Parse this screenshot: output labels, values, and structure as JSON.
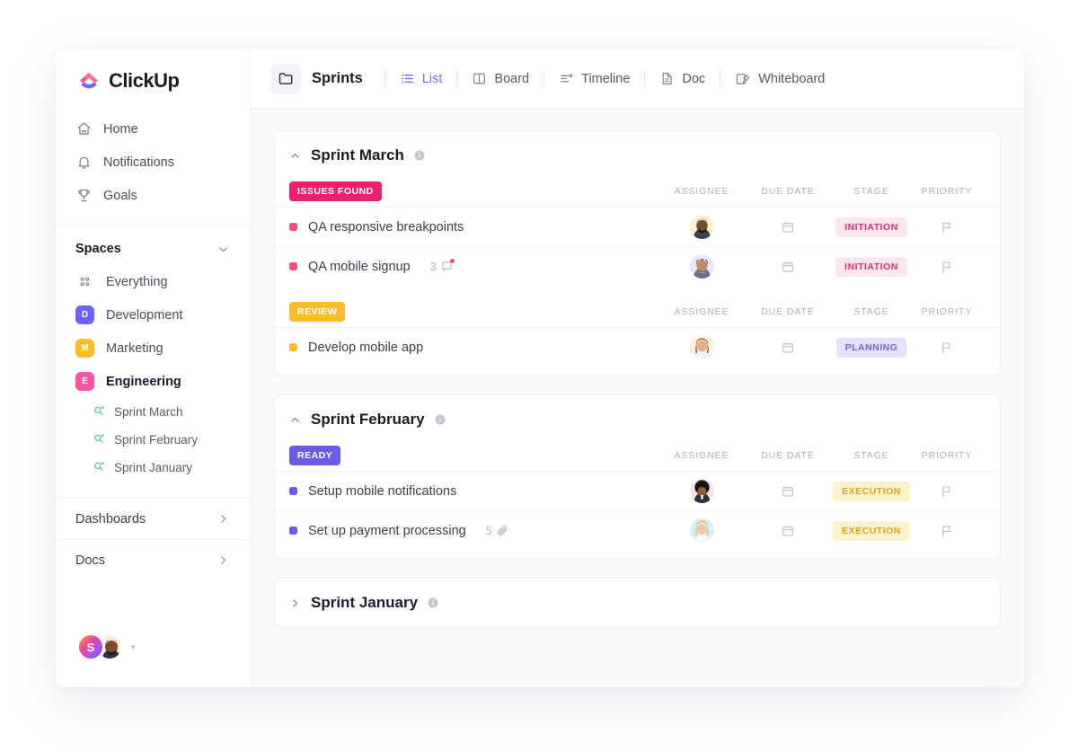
{
  "brand": {
    "name": "ClickUp",
    "accent": "#7b68ee"
  },
  "sidebar": {
    "nav": [
      {
        "label": "Home",
        "icon": "home-icon"
      },
      {
        "label": "Notifications",
        "icon": "bell-icon"
      },
      {
        "label": "Goals",
        "icon": "trophy-icon"
      }
    ],
    "spaces_title": "Spaces",
    "everything": {
      "label": "Everything",
      "icon": "grid-dots-icon"
    },
    "spaces": [
      {
        "label": "Development",
        "initial": "D",
        "color": "#6c63ff",
        "active": false
      },
      {
        "label": "Marketing",
        "initial": "M",
        "color": "#fbbc2e",
        "active": false
      },
      {
        "label": "Engineering",
        "initial": "E",
        "color": "#f754a2",
        "active": true
      }
    ],
    "sprints": [
      {
        "label": "Sprint  March"
      },
      {
        "label": "Sprint  February"
      },
      {
        "label": "Sprint January"
      }
    ],
    "sections": [
      {
        "label": "Dashboards"
      },
      {
        "label": "Docs"
      }
    ],
    "user": {
      "initial": "S"
    }
  },
  "toolbar": {
    "folder": "Sprints",
    "tabs": [
      {
        "label": "List",
        "icon": "list-icon",
        "active": true
      },
      {
        "label": "Board",
        "icon": "board-icon",
        "active": false
      },
      {
        "label": "Timeline",
        "icon": "timeline-icon",
        "active": false
      },
      {
        "label": "Doc",
        "icon": "doc-icon",
        "active": false
      },
      {
        "label": "Whiteboard",
        "icon": "whiteboard-icon",
        "active": false
      }
    ]
  },
  "columns": {
    "assignee": "ASSIGNEE",
    "due_date": "DUE DATE",
    "stage": "STAGE",
    "priority": "PRIORITY"
  },
  "sprints": [
    {
      "name": "Sprint March",
      "expanded": true,
      "groups": [
        {
          "status": "ISSUES FOUND",
          "status_bg": "#e8246c",
          "tasks": [
            {
              "title": "QA responsive breakpoints",
              "dot": "#f04f7f",
              "meta_count": "",
              "meta_icon": "",
              "avatar_bg": "#fdf3d4",
              "avatar_kind": "man-beard",
              "stage": "INITIATION",
              "stage_bg": "#fde6ec",
              "stage_fg": "#e0326b"
            },
            {
              "title": "QA mobile signup",
              "dot": "#f04f7f",
              "meta_count": "3",
              "meta_icon": "comment-icon",
              "avatar_bg": "#ece8fb",
              "avatar_kind": "man-cap",
              "stage": "INITIATION",
              "stage_bg": "#fde6ec",
              "stage_fg": "#e0326b"
            }
          ]
        },
        {
          "status": "REVIEW",
          "status_bg": "#fbbc2e",
          "tasks": [
            {
              "title": "Develop mobile app",
              "dot": "#fbbc2e",
              "meta_count": "",
              "meta_icon": "",
              "avatar_bg": "#fdeedd",
              "avatar_kind": "woman-brown",
              "stage": "PLANNING",
              "stage_bg": "#e4e1fb",
              "stage_fg": "#6c63e8"
            }
          ]
        }
      ]
    },
    {
      "name": "Sprint February",
      "expanded": true,
      "groups": [
        {
          "status": "READY",
          "status_bg": "#6b5ce7",
          "tasks": [
            {
              "title": "Setup mobile notifications",
              "dot": "#6b5ce7",
              "meta_count": "",
              "meta_icon": "",
              "avatar_bg": "#fbe3e7",
              "avatar_kind": "man-afro",
              "stage": "EXECUTION",
              "stage_bg": "#fdf2cf",
              "stage_fg": "#e0a41c"
            },
            {
              "title": "Set up payment processing",
              "dot": "#6b5ce7",
              "meta_count": "5",
              "meta_icon": "attachment-icon",
              "avatar_bg": "#d9eefb",
              "avatar_kind": "woman-blonde",
              "stage": "EXECUTION",
              "stage_bg": "#fdf2cf",
              "stage_fg": "#e0a41c"
            }
          ]
        }
      ]
    },
    {
      "name": "Sprint January",
      "expanded": false,
      "groups": []
    }
  ]
}
